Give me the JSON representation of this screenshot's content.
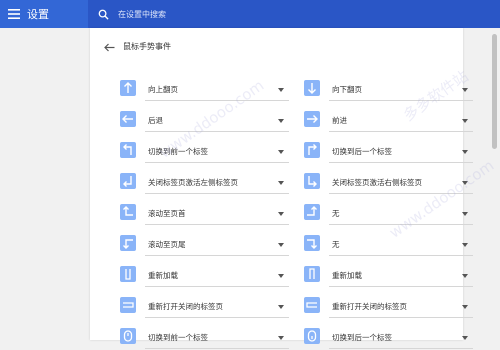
{
  "header": {
    "title": "设置",
    "search_placeholder": "在设置中搜索",
    "accent": "#3367d6"
  },
  "page": {
    "title": "鼠标手势事件"
  },
  "gestures": [
    {
      "icon": "arrow-up-icon",
      "label": "向上翻页"
    },
    {
      "icon": "arrow-down-icon",
      "label": "向下翻页"
    },
    {
      "icon": "arrow-left-icon",
      "label": "后退"
    },
    {
      "icon": "arrow-right-icon",
      "label": "前进"
    },
    {
      "icon": "up-left-icon",
      "label": "切换到前一个标签"
    },
    {
      "icon": "up-right-icon",
      "label": "切换到后一个标签"
    },
    {
      "icon": "down-left-icon",
      "label": "关闭标签页激活左侧标签页"
    },
    {
      "icon": "down-right-icon",
      "label": "关闭标签页激活右侧标签页"
    },
    {
      "icon": "left-up-icon",
      "label": "滚动至页首"
    },
    {
      "icon": "right-up-icon",
      "label": "无"
    },
    {
      "icon": "left-down-icon",
      "label": "滚动至页尾"
    },
    {
      "icon": "right-down-icon",
      "label": "无"
    },
    {
      "icon": "down-up-icon",
      "label": "重新加载"
    },
    {
      "icon": "up-down-icon",
      "label": "重新加载"
    },
    {
      "icon": "right-left-icon",
      "label": "重新打开关闭的标签页"
    },
    {
      "icon": "left-right-icon",
      "label": "重新打开关闭的标签页"
    },
    {
      "icon": "wheel-up-icon",
      "label": "切换到前一个标签"
    },
    {
      "icon": "wheel-down-icon",
      "label": "切换到后一个标签"
    }
  ]
}
